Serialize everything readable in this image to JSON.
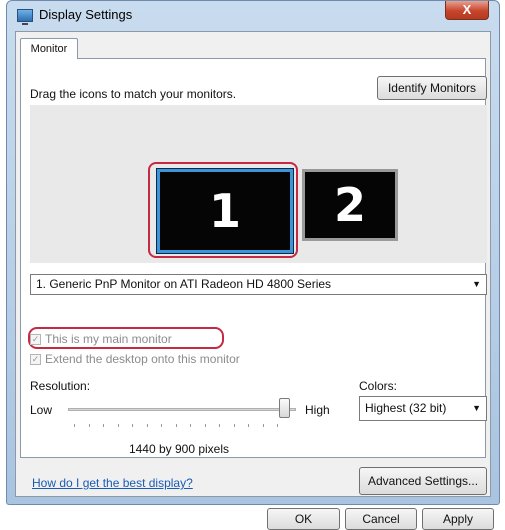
{
  "window": {
    "title": "Display Settings",
    "close_label": "X"
  },
  "tabs": [
    {
      "label": "Monitor"
    }
  ],
  "monitor_tab": {
    "instruction": "Drag the icons to match your monitors.",
    "identify_button": "Identify Monitors",
    "monitors": [
      {
        "number": "1",
        "selected": true
      },
      {
        "number": "2",
        "selected": false
      }
    ],
    "monitor_select": {
      "value": "1. Generic PnP Monitor on ATI Radeon HD 4800 Series"
    },
    "main_monitor_checkbox": {
      "label": "This is my main monitor",
      "checked": true,
      "enabled": false
    },
    "extend_checkbox": {
      "label": "Extend the desktop onto this monitor",
      "checked": true,
      "enabled": false
    },
    "resolution": {
      "label": "Resolution:",
      "low_label": "Low",
      "high_label": "High",
      "slider_level": 1.0,
      "value_text": "1440 by 900 pixels"
    },
    "colors": {
      "label": "Colors:",
      "value": "Highest (32 bit)"
    },
    "help_link": "How do I get the best display?",
    "advanced_button": "Advanced Settings..."
  },
  "buttons": {
    "ok": "OK",
    "cancel": "Cancel",
    "apply": "Apply"
  },
  "colors_theme": {
    "highlight_outline": "#c42a43",
    "selected_monitor_border": "#3e94d8",
    "link": "#1a5bb5"
  }
}
